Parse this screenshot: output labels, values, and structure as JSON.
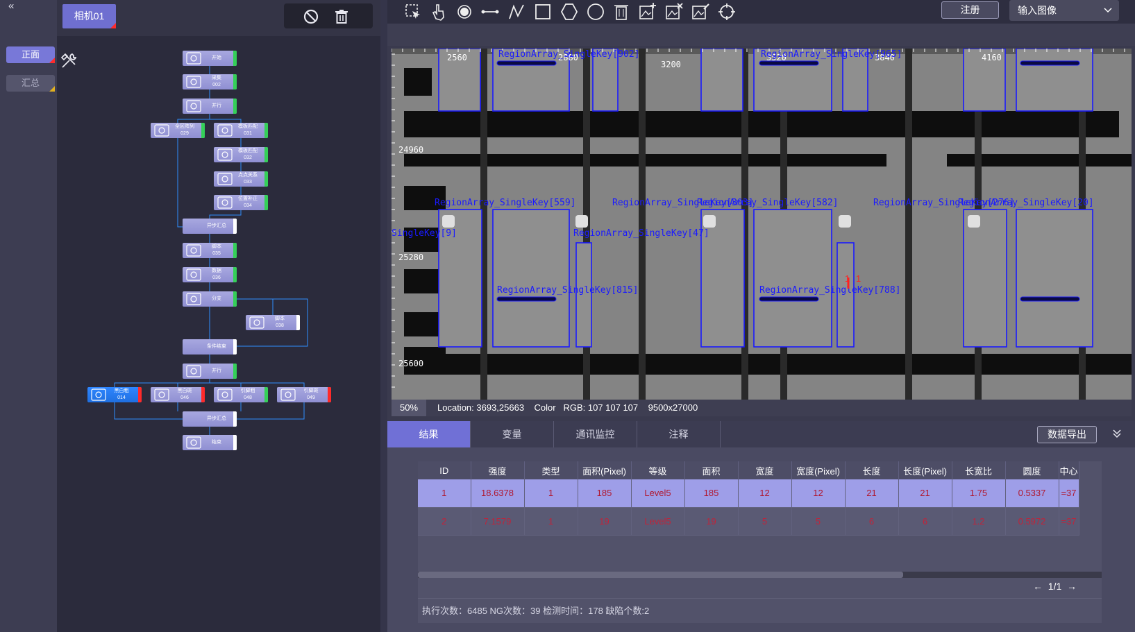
{
  "left": {
    "collapse": "«",
    "tabs": [
      "正面",
      "汇总"
    ]
  },
  "flow": {
    "camera_tab": "相机01",
    "nodes": [
      {
        "id": "start",
        "label": "开始",
        "icon": "power"
      },
      {
        "id": "acquire",
        "label": "采集\n002",
        "icon": "camera"
      },
      {
        "id": "parallel1",
        "label": "并行",
        "icon": "tree"
      },
      {
        "id": "region-array",
        "label": "全区阵列\n029",
        "icon": "grid"
      },
      {
        "id": "tm031",
        "label": "模板匹配\n031",
        "icon": "a-circle"
      },
      {
        "id": "tm032",
        "label": "模板匹配\n032",
        "icon": "a-circle"
      },
      {
        "id": "pp033",
        "label": "点点关系\n033",
        "icon": "line"
      },
      {
        "id": "pos034",
        "label": "位置补正\n034",
        "icon": "axis"
      },
      {
        "id": "async1",
        "label": "异步汇总",
        "icon": "none"
      },
      {
        "id": "script035",
        "label": "脚本\n035",
        "icon": "func"
      },
      {
        "id": "data036",
        "label": "数据\n036",
        "icon": "n-circle"
      },
      {
        "id": "branch",
        "label": "分支",
        "icon": "branch"
      },
      {
        "id": "script038",
        "label": "脚本\n038",
        "icon": "func"
      },
      {
        "id": "cond-end",
        "label": "条件结束",
        "icon": "none"
      },
      {
        "id": "parallel2",
        "label": "并行",
        "icon": "tree"
      },
      {
        "id": "i014",
        "label": "黑白粗\n014",
        "icon": "image"
      },
      {
        "id": "i046",
        "label": "黑白斑\n046",
        "icon": "image"
      },
      {
        "id": "i048",
        "label": "引脚粗\n048",
        "icon": "image"
      },
      {
        "id": "i049",
        "label": "引脚斑\n049",
        "icon": "image"
      },
      {
        "id": "async2",
        "label": "异步汇总",
        "icon": "none"
      },
      {
        "id": "end",
        "label": "结束",
        "icon": "power"
      }
    ]
  },
  "toolbar": {
    "icons": [
      "select-rect-icon",
      "hand-icon",
      "point-icon",
      "line-icon",
      "polyline-icon",
      "rectangle-icon",
      "polygon-icon",
      "circle-icon",
      "delete-icon",
      "image-add-icon",
      "image-remove-icon",
      "image-edit-icon",
      "crosshair-icon"
    ],
    "register": "注册",
    "input_select": "输入图像"
  },
  "image": {
    "ruler_top": [
      "2560",
      "2880",
      "3200",
      "3520",
      "3840",
      "4160"
    ],
    "ruler_left": [
      "24960",
      "25280",
      "25600"
    ],
    "region_labels": [
      "RegionArray_SingleKey[902]",
      "RegionArray_SingleKey[965]",
      "RegionArray_SingleKey[559]",
      "RegionArray_SingleKey[303]",
      "RegionArray_SingleKey[582]",
      "RegionArray_SingleKey[276]",
      "RegionArray_SingleKey[47]",
      "RegionArray_SingleKey[20]",
      "RegionArray_SingleKey[815]",
      "RegionArray_SingleKey[788]",
      "SingleKey[9]"
    ],
    "defect_marks": [
      "1",
      "1"
    ]
  },
  "status": {
    "zoom": "50%",
    "location_label": "Location:",
    "location": "3693,25663",
    "color_label": "Color",
    "rgb": "RGB: 107 107 107",
    "size": "9500x27000"
  },
  "bottom": {
    "tabs": [
      "结果",
      "变量",
      "通讯监控",
      "注释"
    ],
    "export": "数据导出",
    "columns": [
      "ID",
      "强度",
      "类型",
      "面积(Pixel)",
      "等级",
      "面积",
      "宽度",
      "宽度(Pixel)",
      "长度",
      "长度(Pixel)",
      "长宽比",
      "圆度",
      "中心"
    ],
    "rows": [
      [
        "1",
        "18.6378",
        "1",
        "185",
        "Level5",
        "185",
        "12",
        "12",
        "21",
        "21",
        "1.75",
        "0.5337",
        "=37"
      ],
      [
        "2",
        "7.1579",
        "1",
        "19",
        "Level5",
        "19",
        "5",
        "5",
        "6",
        "6",
        "1.2",
        "0.5972",
        "=37"
      ]
    ],
    "scroll_fraction": 0.71,
    "page": "1/1",
    "stats": "执行次数：6485 NG次数：39 检测时间：178 缺陷个数:2"
  },
  "colors": {
    "accent": "#7070d6",
    "node": "#9a9adc",
    "region_outline": "#1a1aff",
    "defect": "#ff2020"
  }
}
